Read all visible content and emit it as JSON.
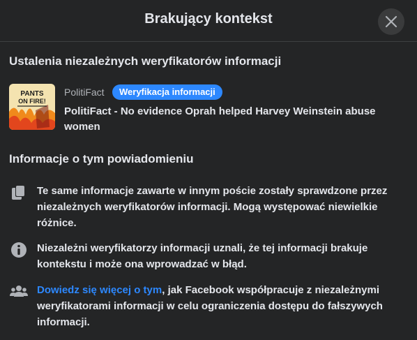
{
  "dialog": {
    "title": "Brakujący kontekst"
  },
  "findings": {
    "heading": "Ustalenia niezależnych weryfikatorów informacji",
    "item": {
      "publisher": "PolitiFact",
      "badge": "Weryfikacja informacji",
      "title": "PolitiFact - No evidence Oprah helped Harvey Weinstein abuse women",
      "thumbnail_text_1": "PANTS",
      "thumbnail_text_2": "ON FIRE!"
    }
  },
  "about": {
    "heading": "Informacje o tym powiadomieniu",
    "items": [
      {
        "icon": "cards-icon",
        "text": "Te same informacje zawarte w innym poście zostały sprawdzone przez niezależnych weryfikatorów informacji. Mogą występować niewielkie różnice."
      },
      {
        "icon": "info-icon",
        "text": "Niezależni weryfikatorzy informacji uznali, że tej informacji brakuje kontekstu i może ona wprowadzać w błąd."
      },
      {
        "icon": "people-icon",
        "link": "Dowiedz się więcej o tym",
        "text": ", jak Facebook współpracuje z niezależnymi weryfikatorami informacji w celu ograniczenia dostępu do fałszywych informacji."
      }
    ]
  },
  "colors": {
    "background": "#242526",
    "accent": "#2d88ff",
    "text": "#e4e6eb",
    "secondary_text": "#b0b3b8"
  }
}
